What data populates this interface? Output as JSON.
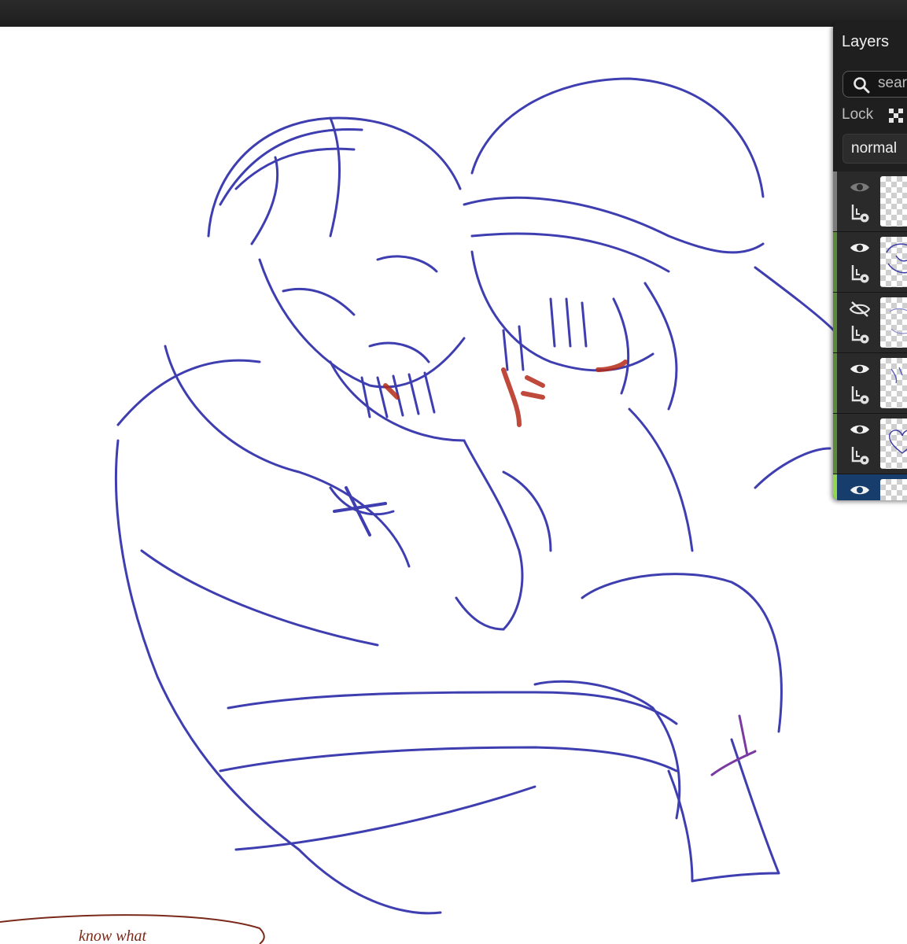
{
  "app": {
    "panel_title": "Layers"
  },
  "search": {
    "placeholder": "search",
    "value": ""
  },
  "lock": {
    "label": "Lock",
    "icon": "checker-lock-icon"
  },
  "blend_mode": {
    "selected": "normal"
  },
  "layers": [
    {
      "visible": true,
      "dimmed": true,
      "selected": false,
      "stripe_color": "#7d7d7d",
      "thumbnail": "empty"
    },
    {
      "visible": true,
      "dimmed": false,
      "selected": false,
      "stripe_color": "#5a8a3a",
      "thumbnail": "sketch"
    },
    {
      "visible": false,
      "dimmed": false,
      "selected": false,
      "stripe_color": "#5a8a3a",
      "thumbnail": "sketch-faint"
    },
    {
      "visible": true,
      "dimmed": false,
      "selected": false,
      "stripe_color": "#5a8a3a",
      "thumbnail": "sketch-small"
    },
    {
      "visible": true,
      "dimmed": false,
      "selected": false,
      "stripe_color": "#5a8a3a",
      "thumbnail": "sketch-heart"
    },
    {
      "visible": true,
      "dimmed": false,
      "selected": true,
      "stripe_color": "#8fd94a",
      "thumbnail": "empty"
    }
  ],
  "canvas": {
    "ink_color": "#2a2aa8",
    "accent_color": "#b52a18",
    "note_color": "#7a2a1a",
    "note_text": "know what"
  },
  "colors": {
    "topbar": "#242424",
    "panel_bg": "#1f1f1f",
    "selected_layer": "#173d6c"
  }
}
